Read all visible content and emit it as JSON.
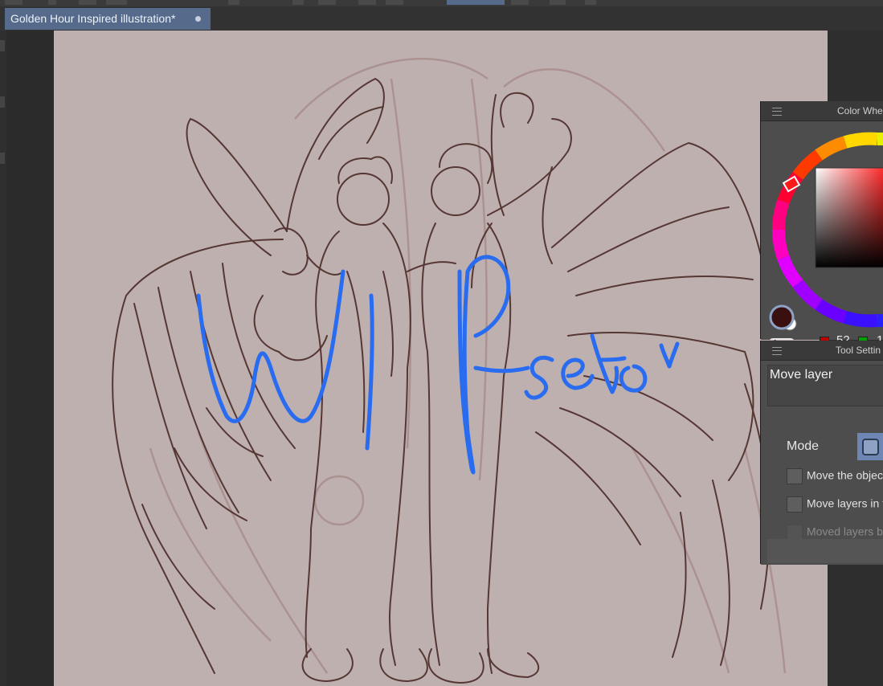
{
  "document_tab": {
    "title": "Golden Hour Inspired illustration*"
  },
  "color_wheel_panel": {
    "title": "Color Whe",
    "value_red": "52",
    "value_green": "1"
  },
  "tool_settings_panel": {
    "title": "Tool Settin",
    "tool_name": "Move layer",
    "mode_label": "Mode",
    "options": [
      "Move the object",
      "Move layers in th",
      "Moved layers be"
    ]
  },
  "colors": {
    "accent": "#566a8c",
    "canvas": "#bfb0b0",
    "sketch_line": "#4a2a26",
    "wip_stroke": "#2a6cf0",
    "main_color": "#3a0f10"
  },
  "canvas_overlay_text": "WIP-seto"
}
